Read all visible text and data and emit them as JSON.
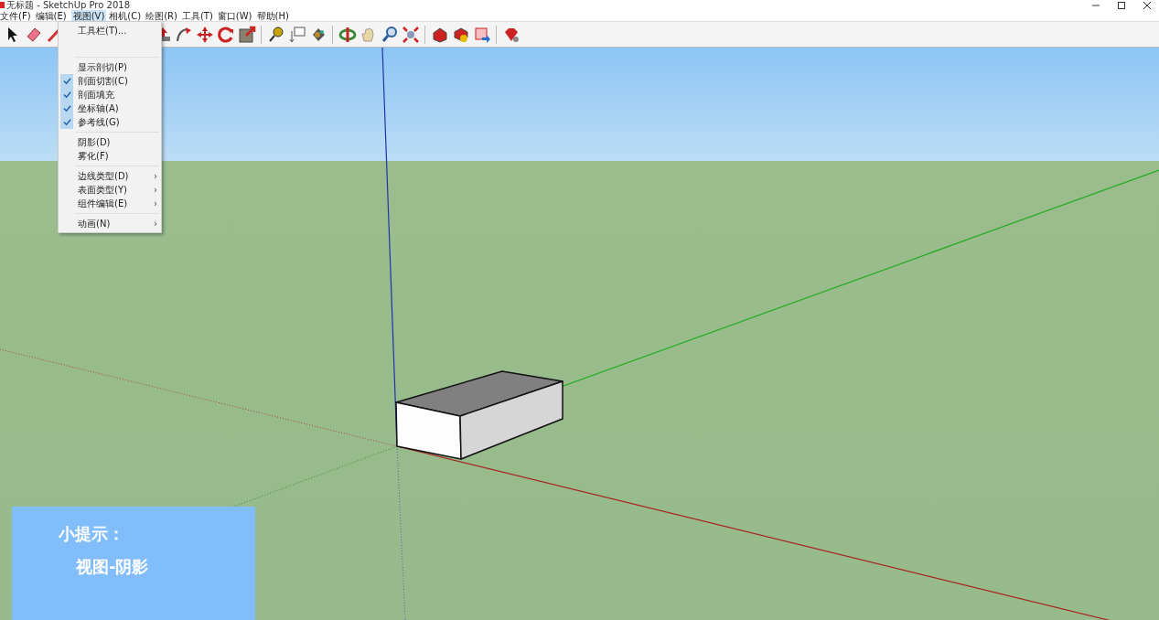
{
  "window": {
    "title": "无标题 - SketchUp Pro 2018"
  },
  "menu_bar": [
    {
      "label": "文件(F)",
      "selected": false
    },
    {
      "label": "编辑(E)",
      "selected": false
    },
    {
      "label": "视图(V)",
      "selected": true
    },
    {
      "label": "相机(C)",
      "selected": false
    },
    {
      "label": "绘图(R)",
      "selected": false
    },
    {
      "label": "工具(T)",
      "selected": false
    },
    {
      "label": "窗口(W)",
      "selected": false
    },
    {
      "label": "帮助(H)",
      "selected": false
    }
  ],
  "view_menu": {
    "groups": [
      [
        {
          "label": "工具栏(T)...",
          "checked": false
        }
      ],
      [
        {
          "label": "显示剖切(P)",
          "checked": false
        },
        {
          "label": "剖面切割(C)",
          "checked": true
        },
        {
          "label": "剖面填充",
          "checked": true
        },
        {
          "label": "坐标轴(A)",
          "checked": true
        },
        {
          "label": "参考线(G)",
          "checked": true
        }
      ],
      [
        {
          "label": "阴影(D)",
          "checked": false
        },
        {
          "label": "雾化(F)",
          "checked": false
        }
      ],
      [
        {
          "label": "边线类型(D)",
          "checked": false,
          "submenu": "›"
        },
        {
          "label": "表面类型(Y)",
          "checked": false,
          "submenu": "›"
        },
        {
          "label": "组件编辑(E)",
          "checked": false,
          "submenu": "›"
        }
      ],
      [
        {
          "label": "动画(N)",
          "checked": false,
          "submenu": "›"
        }
      ]
    ]
  },
  "tip": {
    "title": "小提示：",
    "text": "视图-阴影"
  }
}
